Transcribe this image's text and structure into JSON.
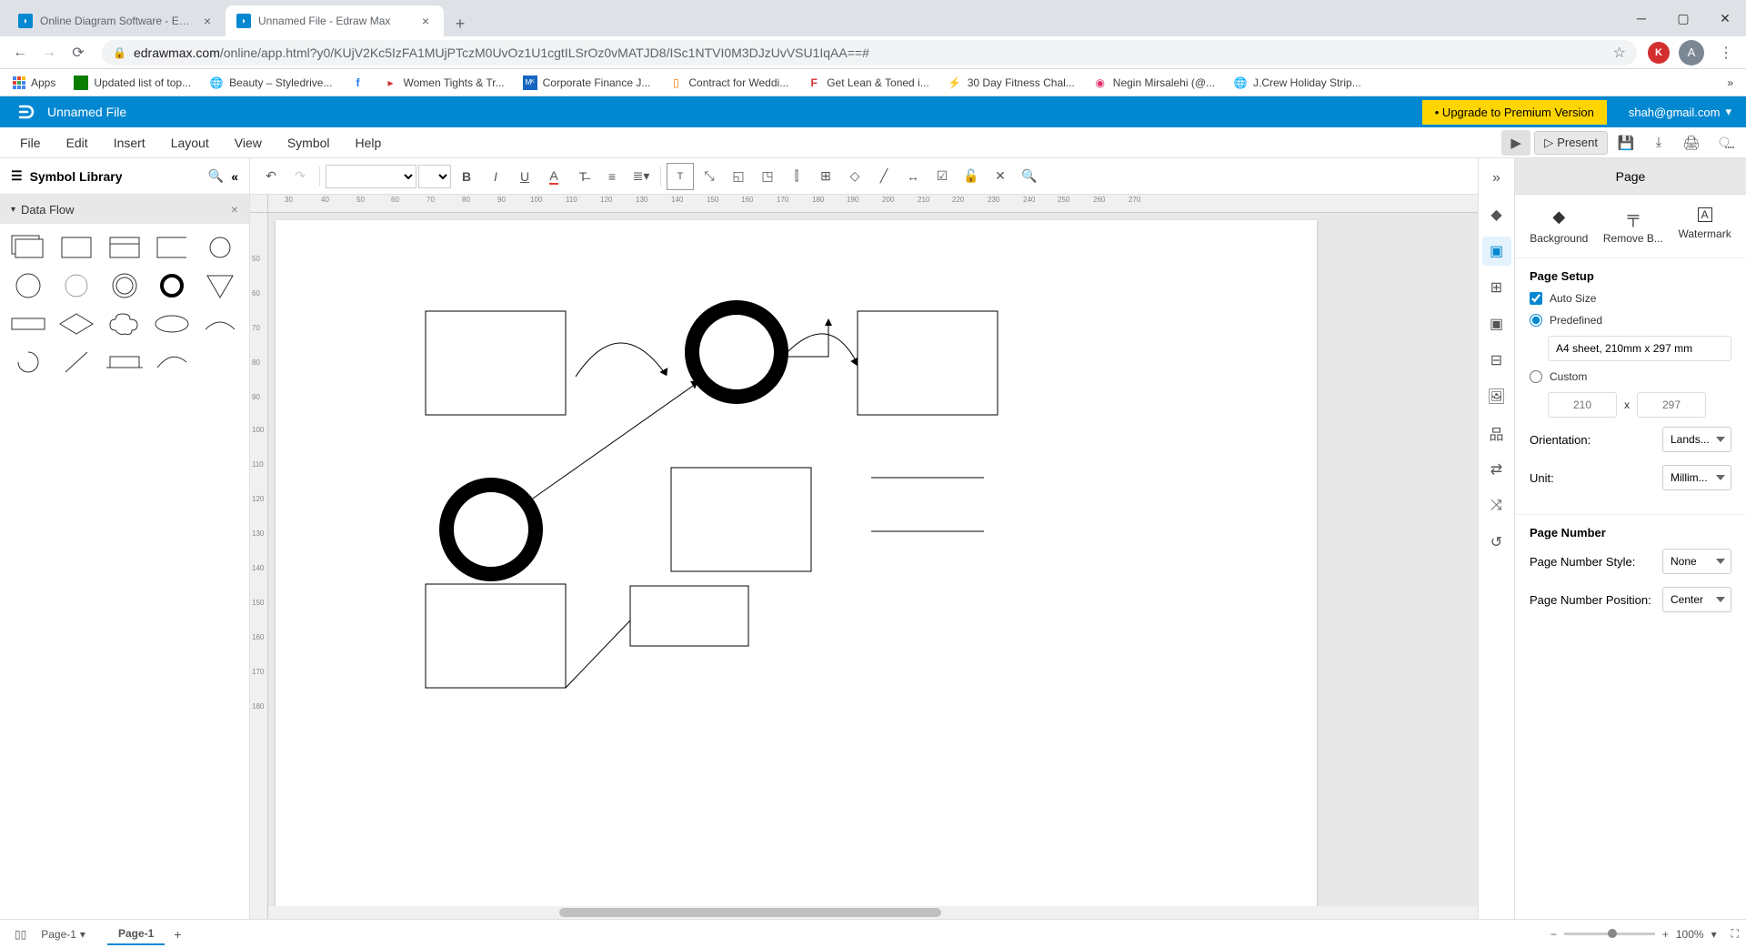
{
  "browser": {
    "tabs": [
      {
        "title": "Online Diagram Software - Edraw",
        "active": false
      },
      {
        "title": "Unnamed File - Edraw Max",
        "active": true
      }
    ],
    "url_domain": "edrawmax.com",
    "url_path": "/online/app.html?y0/KUjV2Kc5IzFA1MUjPTczM0UvOz1U1cgtILSrOz0vMATJD8/ISc1NTVI0M3DJzUvVSU1IqAA==#",
    "bookmarks": [
      {
        "icon": "apps",
        "label": "Apps"
      },
      {
        "icon": "green",
        "label": "Updated list of top..."
      },
      {
        "icon": "globe",
        "label": "Beauty – Styledrive..."
      },
      {
        "icon": "fb",
        "label": ""
      },
      {
        "icon": "red",
        "label": "Women Tights & Tr..."
      },
      {
        "icon": "blue",
        "label": "Corporate Finance J..."
      },
      {
        "icon": "doc",
        "label": "Contract for Weddi..."
      },
      {
        "icon": "fit",
        "label": "Get Lean & Toned i..."
      },
      {
        "icon": "bolt",
        "label": "30 Day Fitness Chal..."
      },
      {
        "icon": "ig",
        "label": "Negin Mirsalehi (@..."
      },
      {
        "icon": "globe",
        "label": "J.Crew Holiday Strip..."
      }
    ]
  },
  "app": {
    "file_name": "Unnamed File",
    "upgrade_label": "• Upgrade to Premium Version",
    "user_email": "shah@gmail.com",
    "menus": [
      "File",
      "Edit",
      "Insert",
      "Layout",
      "View",
      "Symbol",
      "Help"
    ],
    "present_label": "Present"
  },
  "symbol_library": {
    "title": "Symbol Library",
    "category": "Data Flow"
  },
  "right_panel": {
    "title": "Page",
    "actions": [
      "Background",
      "Remove B...",
      "Watermark"
    ],
    "page_setup": {
      "title": "Page Setup",
      "auto_size": "Auto Size",
      "predefined": "Predefined",
      "size_value": "A4 sheet, 210mm x 297 mm",
      "custom": "Custom",
      "width_ph": "210",
      "height_ph": "297",
      "x_label": "x",
      "orientation_label": "Orientation:",
      "orientation_value": "Lands...",
      "unit_label": "Unit:",
      "unit_value": "Millim..."
    },
    "page_number": {
      "title": "Page Number",
      "style_label": "Page Number Style:",
      "style_value": "None",
      "position_label": "Page Number Position:",
      "position_value": "Center"
    }
  },
  "status": {
    "page_select": "Page-1",
    "tab": "Page-1",
    "zoom": "100%"
  }
}
